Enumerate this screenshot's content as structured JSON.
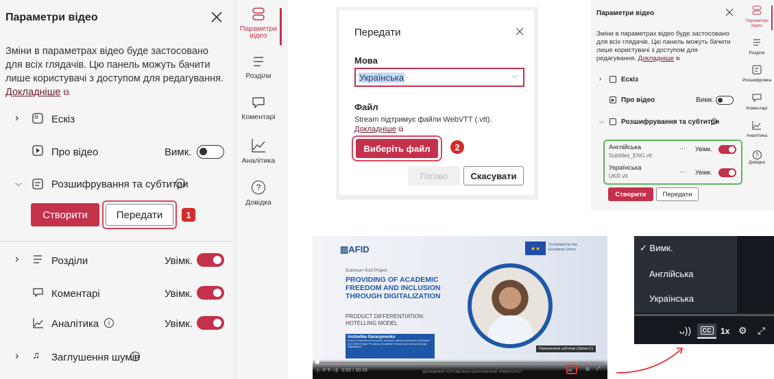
{
  "left": {
    "title": "Параметри відео",
    "description": "Зміни в параметрах відео буде застосовано для всіх глядачів. Цю панель можуть бачити лише користувачі з доступом для редагування.",
    "learn_more": "Докладніше",
    "thumbnail": "Ескіз",
    "about": "Про відео",
    "about_state": "Вимк.",
    "transcripts": "Розшифрування та субтитри",
    "create": "Створити",
    "upload": "Передати",
    "step1": "1",
    "chapters": "Розділи",
    "chapters_state": "Увімк.",
    "comments": "Коментарі",
    "comments_state": "Увімк.",
    "analytics": "Аналітика",
    "analytics_state": "Увімк.",
    "noise": "Заглушення шумів"
  },
  "rail": {
    "video_settings": "Параметри відео",
    "chapters": "Розділи",
    "comments": "Коментарі",
    "analytics": "Аналітика",
    "help": "Довідка"
  },
  "dialog": {
    "title": "Передати",
    "lang_label": "Мова",
    "lang_value": "Українська",
    "file_label": "Файл",
    "file_desc": "Stream підтримує файли WebVTT (.vtt).",
    "learn_more": "Докладніше",
    "choose": "Виберіть файл",
    "step2": "2",
    "done": "Готово",
    "cancel": "Скасувати"
  },
  "right": {
    "title": "Параметри відео",
    "description": "Зміни в параметрах відео буде застосовано для всіх глядачів. Цю панель можуть бачити лише користувачі з доступом для редагування.",
    "learn_more": "Докладніше",
    "thumbnail": "Ескіз",
    "about": "Про відео",
    "about_state": "Вимк.",
    "transcripts": "Розшифрування та субтитри",
    "sub1_lang": "Англійська",
    "sub1_file": "Subtitles_ENG.vtt",
    "sub1_state": "Увімк.",
    "sub2_lang": "Українська",
    "sub2_file": "UKR.vtt",
    "sub2_state": "Увімк.",
    "create": "Створити",
    "upload": "Передати"
  },
  "rail2": {
    "video_settings": "Параметри відео",
    "chapters": "Розділи",
    "rewind": "Розшифровка",
    "comments": "Коментарі",
    "analytics": "Аналітика",
    "help": "Довідка"
  },
  "video": {
    "logo": "AFID",
    "eu": "Co-funded by the European Union",
    "project": "Erasmus+ KA2 Project",
    "headline": "PROVIDING OF ACADEMIC FREEDOM AND INCLUSION THROUGH DIGITALIZATION",
    "sub": "PRODUCT DIFFERENTIATION: HOTELLING MODEL",
    "speaker": "Anzhelika Gerasymenko",
    "speaker_info": "Doctor of Sciences in Economics, professor, national coordinator of Erasmus+ KA2 CBHE Project \"Providing of Academic Freedom and Inclusion through Digitalization\"",
    "tooltip": "Переключити субтитри (Option+C)",
    "time": "0:02 / 10:19",
    "footer": "ДЕРЖАВНИЙ ТОРГОВЕЛЬНО-ЕКОНОМІЧНИЙ УНІВЕРСИТЕТ"
  },
  "captions": {
    "off": "Вимк.",
    "en": "Англійська",
    "uk": "Українська",
    "cc": "CC",
    "speed": "1x"
  },
  "colors": {
    "accent": "#c4314b",
    "badge": "#d42b2b",
    "green": "#4caf50"
  }
}
